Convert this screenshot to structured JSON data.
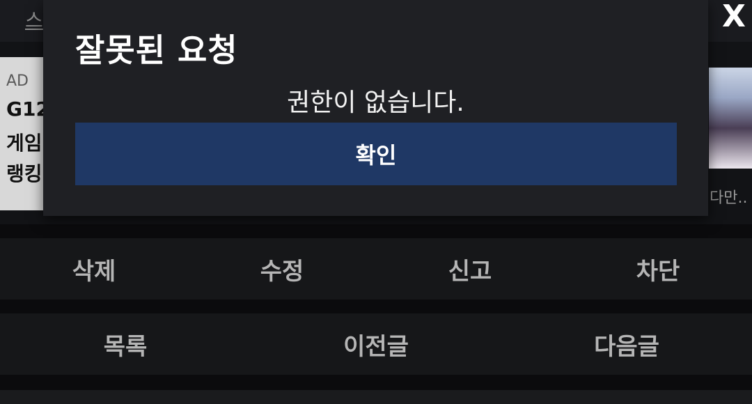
{
  "page": {
    "top_strip_text": "스"
  },
  "ad": {
    "badge": "AD",
    "lines": [
      "G12",
      "게임",
      "랭킹"
    ]
  },
  "side_post": {
    "caption": "다만.."
  },
  "dialog": {
    "title": "잘못된 요청",
    "message": "권한이 없습니다.",
    "confirm_label": "확인",
    "close_label": "X"
  },
  "actions_row1": [
    "삭제",
    "수정",
    "신고",
    "차단"
  ],
  "actions_row2": [
    "목록",
    "이전글",
    "다음글"
  ],
  "colors": {
    "confirm_button": "#1f3865",
    "dialog_bg": "#1f2024",
    "page_bg": "#0b0b0d"
  }
}
